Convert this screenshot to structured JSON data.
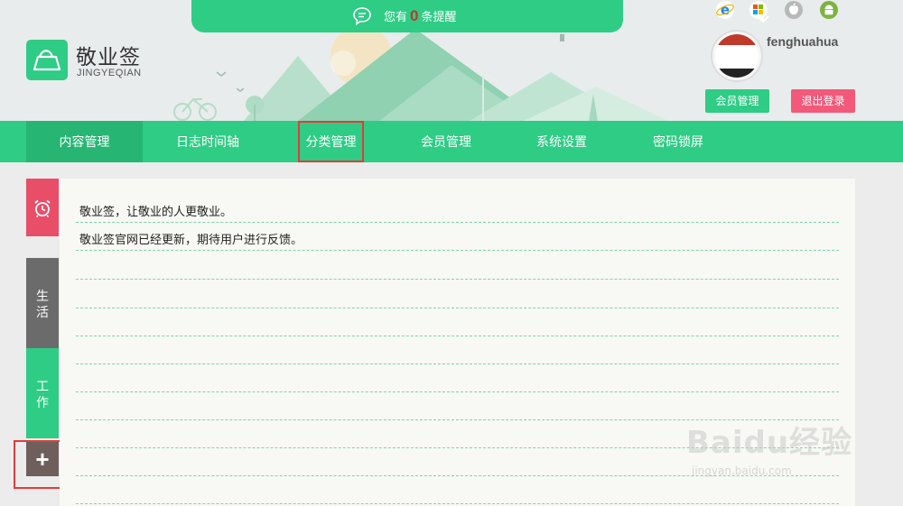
{
  "notification": {
    "prefix": "您有",
    "count": "0",
    "suffix": "条提醒"
  },
  "brand": {
    "name_cn": "敬业签",
    "name_en": "JINGYEQIAN"
  },
  "platforms": [
    "ie-icon",
    "windows-icon",
    "apple-icon",
    "android-icon"
  ],
  "user": {
    "username": "fenghuahua",
    "member_button": "会员管理",
    "logout_button": "退出登录"
  },
  "nav": {
    "items": [
      {
        "label": "内容管理"
      },
      {
        "label": "日志时间轴"
      },
      {
        "label": "分类管理"
      },
      {
        "label": "会员管理"
      },
      {
        "label": "系统设置"
      },
      {
        "label": "密码锁屏"
      }
    ]
  },
  "side_tabs": {
    "life": [
      "生",
      "活"
    ],
    "work": [
      "工",
      "作"
    ],
    "add": "+"
  },
  "notes": [
    "敬业签，让敬业的人更敬业。",
    "敬业签官网已经更新，期待用户进行反馈。"
  ],
  "watermark": {
    "main": "Baidu经验",
    "sub": "jingyan.baidu.com"
  },
  "colors": {
    "primary": "#2ecc85",
    "primary_dark": "#27b574",
    "alarm": "#e94e68",
    "logout": "#f2597a",
    "highlight": "#e23b3b"
  }
}
